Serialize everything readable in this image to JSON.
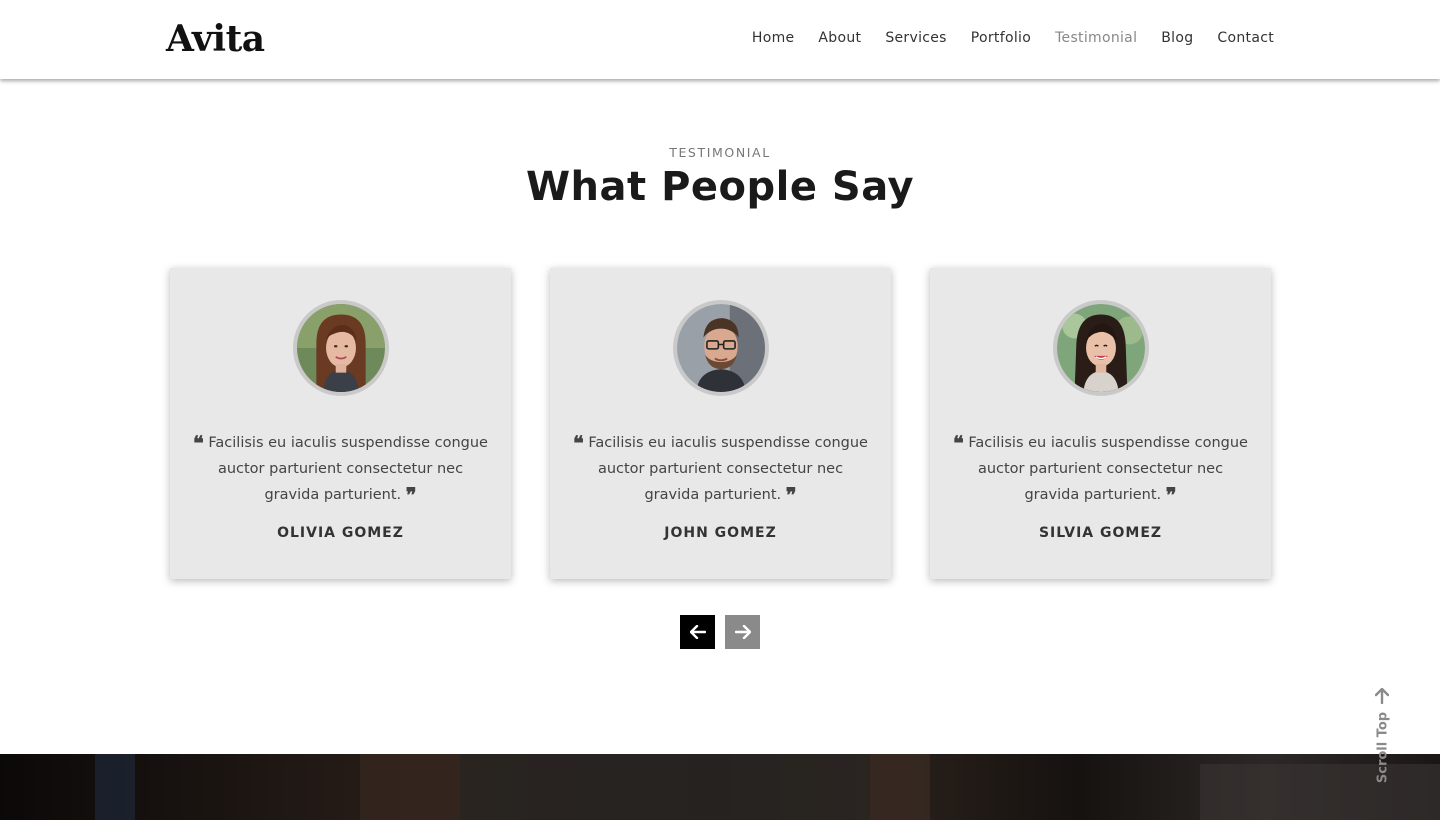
{
  "header": {
    "logo": "Avita",
    "nav": [
      {
        "label": "Home",
        "active": false
      },
      {
        "label": "About",
        "active": false
      },
      {
        "label": "Services",
        "active": false
      },
      {
        "label": "Portfolio",
        "active": false
      },
      {
        "label": "Testimonial",
        "active": true
      },
      {
        "label": "Blog",
        "active": false
      },
      {
        "label": "Contact",
        "active": false
      }
    ]
  },
  "section": {
    "eyebrow": "TESTIMONIAL",
    "title": "What People Say"
  },
  "testimonials": [
    {
      "name": "OLIVIA GOMEZ",
      "quote": "Facilisis eu iaculis suspendisse congue auctor parturient consectetur nec gravida parturient.",
      "avatar_icon": "woman-portrait-icon"
    },
    {
      "name": "JOHN GOMEZ",
      "quote": "Facilisis eu iaculis suspendisse congue auctor parturient consectetur nec gravida parturient.",
      "avatar_icon": "man-portrait-icon"
    },
    {
      "name": "SILVIA GOMEZ",
      "quote": "Facilisis eu iaculis suspendisse congue auctor parturient consectetur nec gravida parturient.",
      "avatar_icon": "woman-portrait-icon"
    }
  ],
  "carousel": {
    "prev_icon": "arrow-left-icon",
    "next_icon": "arrow-right-icon"
  },
  "scroll_top": {
    "label": "Scroll Top",
    "icon": "arrow-up-icon"
  },
  "colors": {
    "card_bg": "#e8e8e8",
    "active_nav": "#888888",
    "prev_button": "#000000",
    "next_button": "#8a8a8a"
  }
}
